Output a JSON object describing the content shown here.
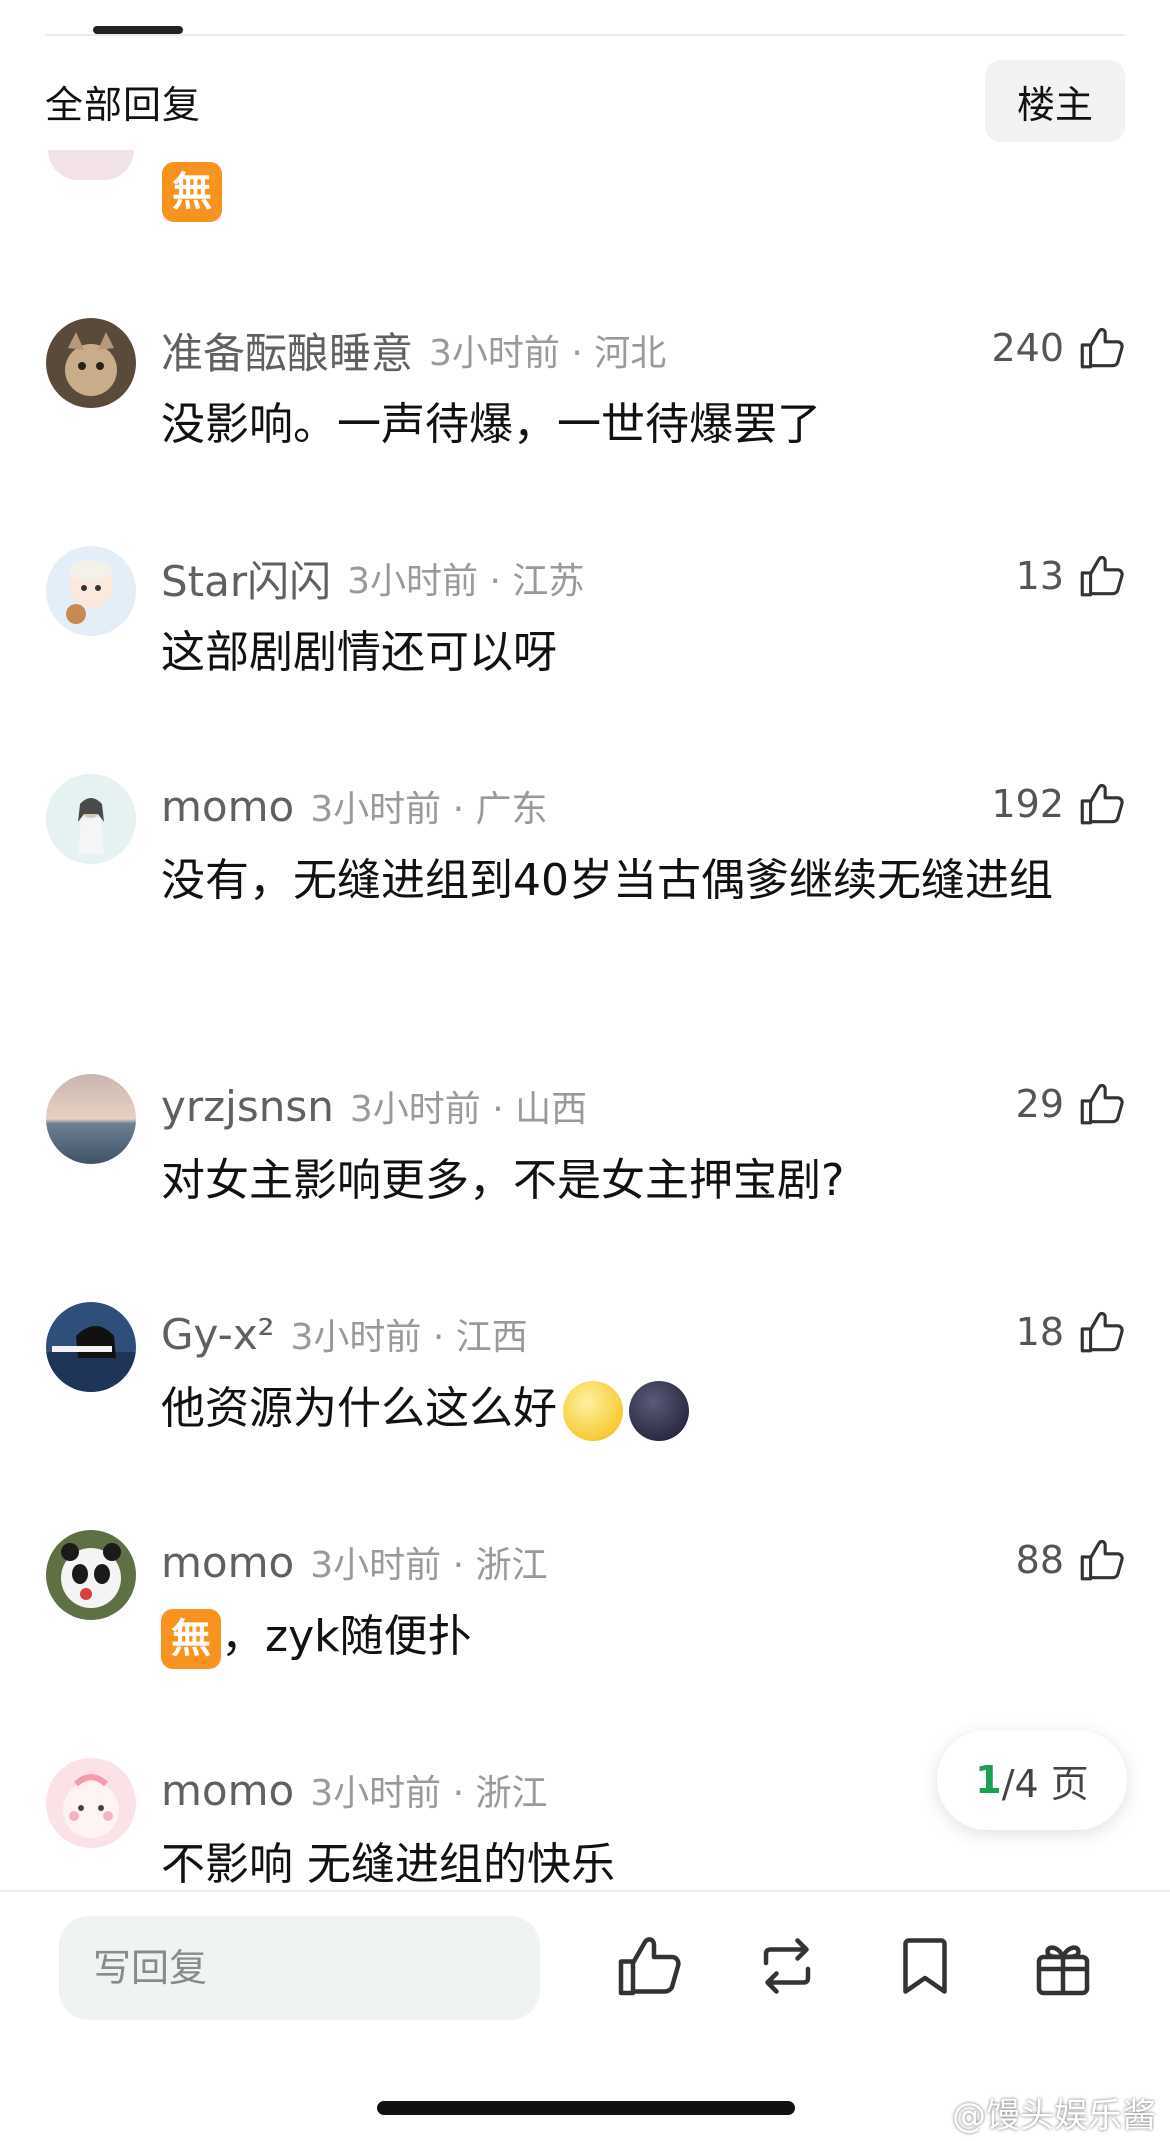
{
  "header": {
    "title": "全部回复",
    "owner_button": "楼主"
  },
  "comments": [
    {
      "username": "准备酝酿睡意",
      "time": "3小时前 · 河北",
      "likes": "240",
      "content": "没影响。一声待爆，一世待爆罢了"
    },
    {
      "username": "Star闪闪",
      "time": "3小时前 · 江苏",
      "likes": "13",
      "content": "这部剧剧情还可以呀"
    },
    {
      "username": "momo",
      "time": "3小时前 · 广东",
      "likes": "192",
      "content": "没有，无缝进组到40岁当古偶爹继续无缝进组"
    },
    {
      "username": "yrzjsnsn",
      "time": "3小时前 · 山西",
      "likes": "29",
      "content": "对女主影响更多，不是女主押宝剧?"
    },
    {
      "username": "Gy-x²",
      "time": "3小时前 · 江西",
      "likes": "18",
      "content": "他资源为什么这么好"
    },
    {
      "username": "momo",
      "time": "3小时前 · 浙江",
      "likes": "88",
      "content": "，zyk随便扑"
    },
    {
      "username": "momo",
      "time": "3小时前 · 浙江",
      "likes": "",
      "content": "不影响 无缝进组的快乐"
    }
  ],
  "emoji": {
    "wu": "無"
  },
  "pagination": {
    "current": "1",
    "rest": "/4 页"
  },
  "bottom_bar": {
    "reply_placeholder": "写回复"
  },
  "watermark": "@馒头娱乐酱",
  "colors": {
    "accent_green": "#1aa051",
    "input_bg": "#eef4ef"
  }
}
